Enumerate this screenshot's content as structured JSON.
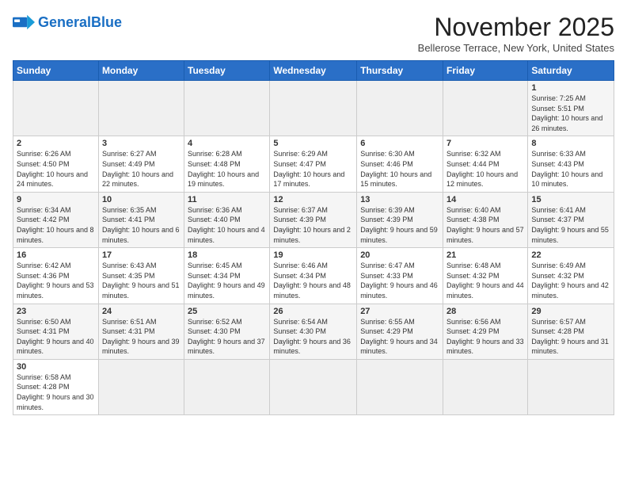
{
  "header": {
    "logo_general": "General",
    "logo_blue": "Blue",
    "month_title": "November 2025",
    "subtitle": "Bellerose Terrace, New York, United States"
  },
  "days_of_week": [
    "Sunday",
    "Monday",
    "Tuesday",
    "Wednesday",
    "Thursday",
    "Friday",
    "Saturday"
  ],
  "weeks": [
    [
      {
        "day": "",
        "info": ""
      },
      {
        "day": "",
        "info": ""
      },
      {
        "day": "",
        "info": ""
      },
      {
        "day": "",
        "info": ""
      },
      {
        "day": "",
        "info": ""
      },
      {
        "day": "",
        "info": ""
      },
      {
        "day": "1",
        "info": "Sunrise: 7:25 AM\nSunset: 5:51 PM\nDaylight: 10 hours and 26 minutes."
      }
    ],
    [
      {
        "day": "2",
        "info": "Sunrise: 6:26 AM\nSunset: 4:50 PM\nDaylight: 10 hours and 24 minutes."
      },
      {
        "day": "3",
        "info": "Sunrise: 6:27 AM\nSunset: 4:49 PM\nDaylight: 10 hours and 22 minutes."
      },
      {
        "day": "4",
        "info": "Sunrise: 6:28 AM\nSunset: 4:48 PM\nDaylight: 10 hours and 19 minutes."
      },
      {
        "day": "5",
        "info": "Sunrise: 6:29 AM\nSunset: 4:47 PM\nDaylight: 10 hours and 17 minutes."
      },
      {
        "day": "6",
        "info": "Sunrise: 6:30 AM\nSunset: 4:46 PM\nDaylight: 10 hours and 15 minutes."
      },
      {
        "day": "7",
        "info": "Sunrise: 6:32 AM\nSunset: 4:44 PM\nDaylight: 10 hours and 12 minutes."
      },
      {
        "day": "8",
        "info": "Sunrise: 6:33 AM\nSunset: 4:43 PM\nDaylight: 10 hours and 10 minutes."
      }
    ],
    [
      {
        "day": "9",
        "info": "Sunrise: 6:34 AM\nSunset: 4:42 PM\nDaylight: 10 hours and 8 minutes."
      },
      {
        "day": "10",
        "info": "Sunrise: 6:35 AM\nSunset: 4:41 PM\nDaylight: 10 hours and 6 minutes."
      },
      {
        "day": "11",
        "info": "Sunrise: 6:36 AM\nSunset: 4:40 PM\nDaylight: 10 hours and 4 minutes."
      },
      {
        "day": "12",
        "info": "Sunrise: 6:37 AM\nSunset: 4:39 PM\nDaylight: 10 hours and 2 minutes."
      },
      {
        "day": "13",
        "info": "Sunrise: 6:39 AM\nSunset: 4:39 PM\nDaylight: 9 hours and 59 minutes."
      },
      {
        "day": "14",
        "info": "Sunrise: 6:40 AM\nSunset: 4:38 PM\nDaylight: 9 hours and 57 minutes."
      },
      {
        "day": "15",
        "info": "Sunrise: 6:41 AM\nSunset: 4:37 PM\nDaylight: 9 hours and 55 minutes."
      }
    ],
    [
      {
        "day": "16",
        "info": "Sunrise: 6:42 AM\nSunset: 4:36 PM\nDaylight: 9 hours and 53 minutes."
      },
      {
        "day": "17",
        "info": "Sunrise: 6:43 AM\nSunset: 4:35 PM\nDaylight: 9 hours and 51 minutes."
      },
      {
        "day": "18",
        "info": "Sunrise: 6:45 AM\nSunset: 4:34 PM\nDaylight: 9 hours and 49 minutes."
      },
      {
        "day": "19",
        "info": "Sunrise: 6:46 AM\nSunset: 4:34 PM\nDaylight: 9 hours and 48 minutes."
      },
      {
        "day": "20",
        "info": "Sunrise: 6:47 AM\nSunset: 4:33 PM\nDaylight: 9 hours and 46 minutes."
      },
      {
        "day": "21",
        "info": "Sunrise: 6:48 AM\nSunset: 4:32 PM\nDaylight: 9 hours and 44 minutes."
      },
      {
        "day": "22",
        "info": "Sunrise: 6:49 AM\nSunset: 4:32 PM\nDaylight: 9 hours and 42 minutes."
      }
    ],
    [
      {
        "day": "23",
        "info": "Sunrise: 6:50 AM\nSunset: 4:31 PM\nDaylight: 9 hours and 40 minutes."
      },
      {
        "day": "24",
        "info": "Sunrise: 6:51 AM\nSunset: 4:31 PM\nDaylight: 9 hours and 39 minutes."
      },
      {
        "day": "25",
        "info": "Sunrise: 6:52 AM\nSunset: 4:30 PM\nDaylight: 9 hours and 37 minutes."
      },
      {
        "day": "26",
        "info": "Sunrise: 6:54 AM\nSunset: 4:30 PM\nDaylight: 9 hours and 36 minutes."
      },
      {
        "day": "27",
        "info": "Sunrise: 6:55 AM\nSunset: 4:29 PM\nDaylight: 9 hours and 34 minutes."
      },
      {
        "day": "28",
        "info": "Sunrise: 6:56 AM\nSunset: 4:29 PM\nDaylight: 9 hours and 33 minutes."
      },
      {
        "day": "29",
        "info": "Sunrise: 6:57 AM\nSunset: 4:28 PM\nDaylight: 9 hours and 31 minutes."
      }
    ],
    [
      {
        "day": "30",
        "info": "Sunrise: 6:58 AM\nSunset: 4:28 PM\nDaylight: 9 hours and 30 minutes."
      },
      {
        "day": "",
        "info": ""
      },
      {
        "day": "",
        "info": ""
      },
      {
        "day": "",
        "info": ""
      },
      {
        "day": "",
        "info": ""
      },
      {
        "day": "",
        "info": ""
      },
      {
        "day": "",
        "info": ""
      }
    ]
  ]
}
